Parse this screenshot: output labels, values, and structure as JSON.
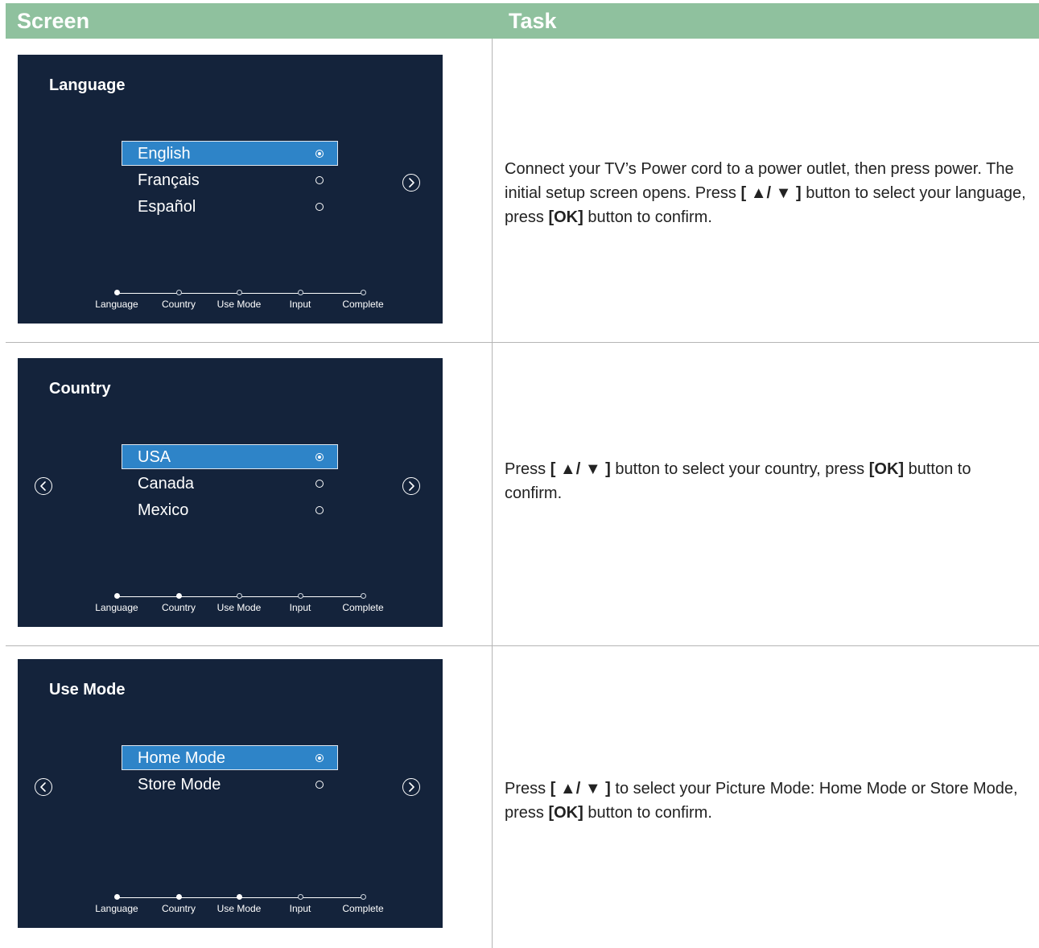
{
  "header": {
    "screen": "Screen",
    "task": "Task"
  },
  "steps": [
    "Language",
    "Country",
    "Use Mode",
    "Input",
    "Complete"
  ],
  "colors": {
    "header": "#8fc19e",
    "tv_bg": "#14233b",
    "selected": "#2e84c8"
  },
  "rows": [
    {
      "title": "Language",
      "options": [
        "English",
        "Français",
        "Español"
      ],
      "selected": 0,
      "progress": 1,
      "arrows": {
        "left": false,
        "right": true
      },
      "task_parts": [
        {
          "t": "Connect your TV’s Power cord to a power outlet, then press power. The initial setup screen opens. Press "
        },
        {
          "t": "[ ▲/ ▼ ]",
          "b": true
        },
        {
          "t": " button to select your language, press "
        },
        {
          "t": "[OK]",
          "b": true
        },
        {
          "t": " button to confirm."
        }
      ]
    },
    {
      "title": "Country",
      "options": [
        "USA",
        "Canada",
        "Mexico"
      ],
      "selected": 0,
      "progress": 2,
      "arrows": {
        "left": true,
        "right": true
      },
      "task_parts": [
        {
          "t": "Press "
        },
        {
          "t": "[ ▲/ ▼ ]",
          "b": true
        },
        {
          "t": " button to select your country, press "
        },
        {
          "t": "[OK]",
          "b": true
        },
        {
          "t": " button to confirm."
        }
      ]
    },
    {
      "title": "Use Mode",
      "options": [
        "Home Mode",
        "Store Mode"
      ],
      "selected": 0,
      "progress": 3,
      "arrows": {
        "left": true,
        "right": true
      },
      "task_parts": [
        {
          "t": "Press "
        },
        {
          "t": "[ ▲/ ▼ ]",
          "b": true
        },
        {
          "t": " to select your Picture Mode: Home Mode or Store Mode, press "
        },
        {
          "t": "[OK]",
          "b": true
        },
        {
          "t": " button to confirm."
        }
      ]
    }
  ]
}
